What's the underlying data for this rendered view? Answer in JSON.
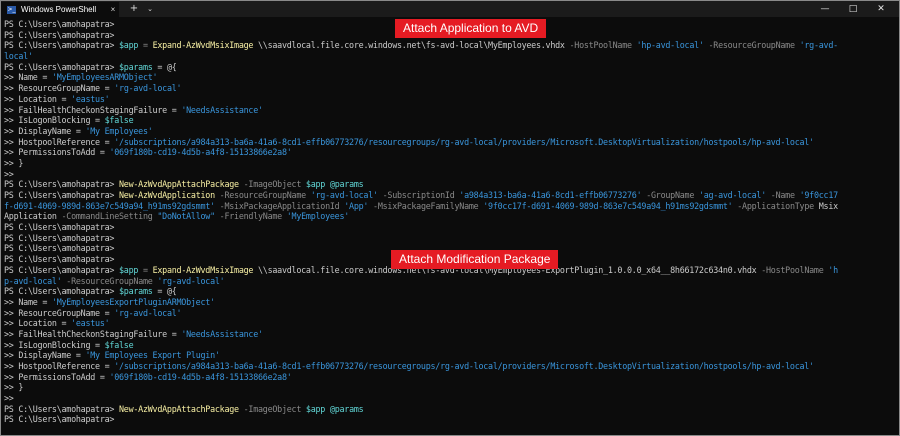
{
  "window": {
    "tab_title": "Windows PowerShell",
    "tab_icon": "powershell-icon",
    "new_tab_symbol": "+",
    "dropdown_symbol": "⌄",
    "close_tab_symbol": "×",
    "controls": {
      "minimize": "—",
      "maximize": "□",
      "close": "✕"
    }
  },
  "banners": {
    "attach_application": "Attach Application to AVD",
    "attach_modification": "Attach Modification Package"
  },
  "colors": {
    "background": "#0c0c0c",
    "text": "#cccccc",
    "command": "#f9f1a5",
    "string": "#3a96dd",
    "parameter": "#8a8a8a",
    "variable": "#61d6d6",
    "banner": "#e51b23"
  },
  "terminal": {
    "lines": [
      [
        {
          "t": "PS C:\\Users\\amohapatra> ",
          "c": ""
        }
      ],
      [
        {
          "t": "PS C:\\Users\\amohapatra> ",
          "c": ""
        }
      ],
      [
        {
          "t": "PS C:\\Users\\amohapatra> ",
          "c": ""
        },
        {
          "t": "$app",
          "c": "var"
        },
        {
          "t": " = ",
          "c": "op"
        },
        {
          "t": "Expand-AzWvdMsixImage",
          "c": "cmd"
        },
        {
          "t": " \\\\saavdlocal.file.core.windows.net\\fs-avd-local\\MyEmployees.vhdx ",
          "c": ""
        },
        {
          "t": "-HostPoolName",
          "c": "par"
        },
        {
          "t": " 'hp-avd-local'",
          "c": "str"
        },
        {
          "t": " -ResourceGroupName",
          "c": "par"
        },
        {
          "t": " 'rg-avd-",
          "c": "str"
        }
      ],
      [
        {
          "t": "local'",
          "c": "str"
        }
      ],
      [
        {
          "t": "PS C:\\Users\\amohapatra> ",
          "c": ""
        },
        {
          "t": "$params",
          "c": "var"
        },
        {
          "t": " = @{",
          "c": ""
        }
      ],
      [
        {
          "t": ">> Name = ",
          "c": ""
        },
        {
          "t": "'MyEmployeesARMObject'",
          "c": "str"
        }
      ],
      [
        {
          "t": ">> ResourceGroupName = ",
          "c": ""
        },
        {
          "t": "'rg-avd-local'",
          "c": "str"
        }
      ],
      [
        {
          "t": ">> Location = ",
          "c": ""
        },
        {
          "t": "'eastus'",
          "c": "str"
        }
      ],
      [
        {
          "t": ">> FailHealthCheckonStagingFailure = ",
          "c": ""
        },
        {
          "t": "'NeedsAssistance'",
          "c": "str"
        }
      ],
      [
        {
          "t": ">> IsLogonBlocking = ",
          "c": ""
        },
        {
          "t": "$false",
          "c": "var"
        }
      ],
      [
        {
          "t": ">> DisplayName = ",
          "c": ""
        },
        {
          "t": "'My Employees'",
          "c": "str"
        }
      ],
      [
        {
          "t": ">> HostpoolReference = ",
          "c": ""
        },
        {
          "t": "'/subscriptions/a984a313-ba6a-41a6-8cd1-effb06773276/resourcegroups/rg-avd-local/providers/Microsoft.DesktopVirtualization/hostpools/hp-avd-local'",
          "c": "str"
        }
      ],
      [
        {
          "t": ">> PermissionsToAdd = ",
          "c": ""
        },
        {
          "t": "'069f180b-cd19-4d5b-a4f8-15133866e2a8'",
          "c": "str"
        }
      ],
      [
        {
          "t": ">> }",
          "c": ""
        }
      ],
      [
        {
          "t": ">>",
          "c": ""
        }
      ],
      [
        {
          "t": "PS C:\\Users\\amohapatra> ",
          "c": ""
        },
        {
          "t": "New-AzWvdAppAttachPackage",
          "c": "cmd"
        },
        {
          "t": " -ImageObject",
          "c": "par"
        },
        {
          "t": " $app",
          "c": "var"
        },
        {
          "t": " @params",
          "c": "var"
        }
      ],
      [
        {
          "t": "PS C:\\Users\\amohapatra> ",
          "c": ""
        },
        {
          "t": "New-AzWvdApplication",
          "c": "cmd"
        },
        {
          "t": " -ResourceGroupName",
          "c": "par"
        },
        {
          "t": " 'rg-avd-local'",
          "c": "str"
        },
        {
          "t": " -SubscriptionId",
          "c": "par"
        },
        {
          "t": " 'a984a313-ba6a-41a6-8cd1-effb06773276'",
          "c": "str"
        },
        {
          "t": " -GroupName",
          "c": "par"
        },
        {
          "t": " 'ag-avd-local'",
          "c": "str"
        },
        {
          "t": " -Name",
          "c": "par"
        },
        {
          "t": " '9f0cc17",
          "c": "str"
        }
      ],
      [
        {
          "t": "f-d691-4069-989d-863e7c549a94_h91ms92gdsmmt'",
          "c": "str"
        },
        {
          "t": " -MsixPackageApplicationId",
          "c": "par"
        },
        {
          "t": " 'App'",
          "c": "str"
        },
        {
          "t": " -MsixPackageFamilyName",
          "c": "par"
        },
        {
          "t": " '9f0cc17f-d691-4069-989d-863e7c549a94_h91ms92gdsmmt'",
          "c": "str"
        },
        {
          "t": " -ApplicationType",
          "c": "par"
        },
        {
          "t": " Msix",
          "c": ""
        }
      ],
      [
        {
          "t": "Application",
          "c": ""
        },
        {
          "t": " -CommandLineSetting",
          "c": "par"
        },
        {
          "t": " \"DoNotAllow\"",
          "c": "str"
        },
        {
          "t": " -FriendlyName",
          "c": "par"
        },
        {
          "t": " 'MyEmployees'",
          "c": "str"
        }
      ],
      [
        {
          "t": "PS C:\\Users\\amohapatra>",
          "c": ""
        }
      ],
      [
        {
          "t": "PS C:\\Users\\amohapatra>",
          "c": ""
        }
      ],
      [
        {
          "t": "PS C:\\Users\\amohapatra>",
          "c": ""
        }
      ],
      [
        {
          "t": "PS C:\\Users\\amohapatra>",
          "c": ""
        }
      ],
      [
        {
          "t": "PS C:\\Users\\amohapatra> ",
          "c": ""
        },
        {
          "t": "$app",
          "c": "var"
        },
        {
          "t": " = ",
          "c": "op"
        },
        {
          "t": "Expand-AzWvdMsixImage",
          "c": "cmd"
        },
        {
          "t": " \\\\saavdlocal.file.core.windows.net\\fs-avd-local\\MyEmployees-ExportPlugin_1.0.0.0_x64__8h66172c634n0.vhdx ",
          "c": ""
        },
        {
          "t": "-HostPoolName",
          "c": "par"
        },
        {
          "t": " 'h",
          "c": "str"
        }
      ],
      [
        {
          "t": "p-avd-local'",
          "c": "str"
        },
        {
          "t": " -ResourceGroupName",
          "c": "par"
        },
        {
          "t": " 'rg-avd-local'",
          "c": "str"
        }
      ],
      [
        {
          "t": "PS C:\\Users\\amohapatra> ",
          "c": ""
        },
        {
          "t": "$params",
          "c": "var"
        },
        {
          "t": " = @{",
          "c": ""
        }
      ],
      [
        {
          "t": ">> Name = ",
          "c": ""
        },
        {
          "t": "'MyEmployeesExportPluginARMObject'",
          "c": "str"
        }
      ],
      [
        {
          "t": ">> ResourceGroupName = ",
          "c": ""
        },
        {
          "t": "'rg-avd-local'",
          "c": "str"
        }
      ],
      [
        {
          "t": ">> Location = ",
          "c": ""
        },
        {
          "t": "'eastus'",
          "c": "str"
        }
      ],
      [
        {
          "t": ">> FailHealthCheckonStagingFailure = ",
          "c": ""
        },
        {
          "t": "'NeedsAssistance'",
          "c": "str"
        }
      ],
      [
        {
          "t": ">> IsLogonBlocking = ",
          "c": ""
        },
        {
          "t": "$false",
          "c": "var"
        }
      ],
      [
        {
          "t": ">> DisplayName = ",
          "c": ""
        },
        {
          "t": "'My Employees Export Plugin'",
          "c": "str"
        }
      ],
      [
        {
          "t": ">> HostpoolReference = ",
          "c": ""
        },
        {
          "t": "'/subscriptions/a984a313-ba6a-41a6-8cd1-effb06773276/resourcegroups/rg-avd-local/providers/Microsoft.DesktopVirtualization/hostpools/hp-avd-local'",
          "c": "str"
        }
      ],
      [
        {
          "t": ">> PermissionsToAdd = ",
          "c": ""
        },
        {
          "t": "'069f180b-cd19-4d5b-a4f8-15133866e2a8'",
          "c": "str"
        }
      ],
      [
        {
          "t": ">> }",
          "c": ""
        }
      ],
      [
        {
          "t": ">>",
          "c": ""
        }
      ],
      [
        {
          "t": "PS C:\\Users\\amohapatra> ",
          "c": ""
        },
        {
          "t": "New-AzWvdAppAttachPackage",
          "c": "cmd"
        },
        {
          "t": " -ImageObject",
          "c": "par"
        },
        {
          "t": " $app",
          "c": "var"
        },
        {
          "t": " @params",
          "c": "var"
        }
      ],
      [
        {
          "t": "PS C:\\Users\\amohapatra>",
          "c": ""
        }
      ]
    ]
  }
}
